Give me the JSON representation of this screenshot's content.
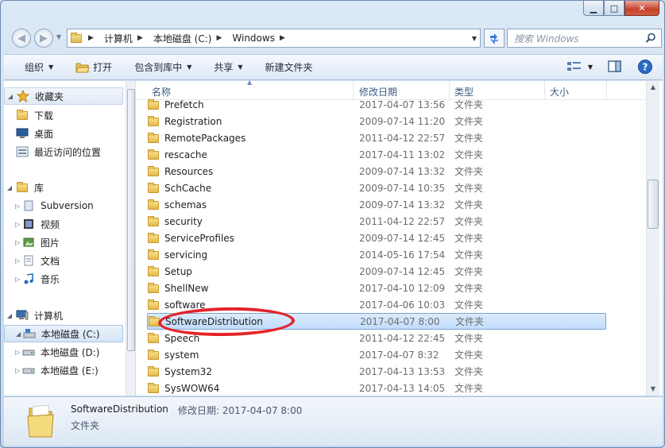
{
  "window": {
    "caption": {
      "minimize": "▁",
      "maximize": "□",
      "close": "✕"
    }
  },
  "address": {
    "crumbs": [
      "计算机",
      "本地磁盘 (C:)",
      "Windows"
    ],
    "search_placeholder": "搜索 Windows"
  },
  "toolbar": {
    "organize": "组织",
    "open": "打开",
    "include_in_library": "包含到库中",
    "share": "共享",
    "new_folder": "新建文件夹"
  },
  "sidebar": {
    "favorites": "收藏夹",
    "downloads": "下载",
    "desktop": "桌面",
    "recent": "最近访问的位置",
    "libraries": "库",
    "subversion": "Subversion",
    "videos": "视频",
    "pictures": "图片",
    "documents": "文档",
    "music": "音乐",
    "computer": "计算机",
    "drive_c": "本地磁盘 (C:)",
    "drive_d": "本地磁盘 (D:)",
    "drive_e": "本地磁盘 (E:)"
  },
  "columns": {
    "name": "名称",
    "modified": "修改日期",
    "type": "类型",
    "size": "大小"
  },
  "files": [
    {
      "name": "Prefetch",
      "date": "2017-04-07 13:56",
      "type": "文件夹"
    },
    {
      "name": "Registration",
      "date": "2009-07-14 11:20",
      "type": "文件夹"
    },
    {
      "name": "RemotePackages",
      "date": "2011-04-12 22:57",
      "type": "文件夹"
    },
    {
      "name": "rescache",
      "date": "2017-04-11 13:02",
      "type": "文件夹"
    },
    {
      "name": "Resources",
      "date": "2009-07-14 13:32",
      "type": "文件夹"
    },
    {
      "name": "SchCache",
      "date": "2009-07-14 10:35",
      "type": "文件夹"
    },
    {
      "name": "schemas",
      "date": "2009-07-14 13:32",
      "type": "文件夹"
    },
    {
      "name": "security",
      "date": "2011-04-12 22:57",
      "type": "文件夹"
    },
    {
      "name": "ServiceProfiles",
      "date": "2009-07-14 12:45",
      "type": "文件夹"
    },
    {
      "name": "servicing",
      "date": "2014-05-16 17:54",
      "type": "文件夹"
    },
    {
      "name": "Setup",
      "date": "2009-07-14 12:45",
      "type": "文件夹"
    },
    {
      "name": "ShellNew",
      "date": "2017-04-10 12:09",
      "type": "文件夹"
    },
    {
      "name": "software",
      "date": "2017-04-06 10:03",
      "type": "文件夹"
    },
    {
      "name": "SoftwareDistribution",
      "date": "2017-04-07 8:00",
      "type": "文件夹"
    },
    {
      "name": "Speech",
      "date": "2011-04-12 22:45",
      "type": "文件夹"
    },
    {
      "name": "system",
      "date": "2017-04-07 8:32",
      "type": "文件夹"
    },
    {
      "name": "System32",
      "date": "2017-04-13 13:53",
      "type": "文件夹"
    },
    {
      "name": "SysWOW64",
      "date": "2017-04-13 14:05",
      "type": "文件夹"
    }
  ],
  "details": {
    "name": "SoftwareDistribution",
    "meta": "修改日期: 2017-04-07 8:00",
    "type": "文件夹"
  }
}
